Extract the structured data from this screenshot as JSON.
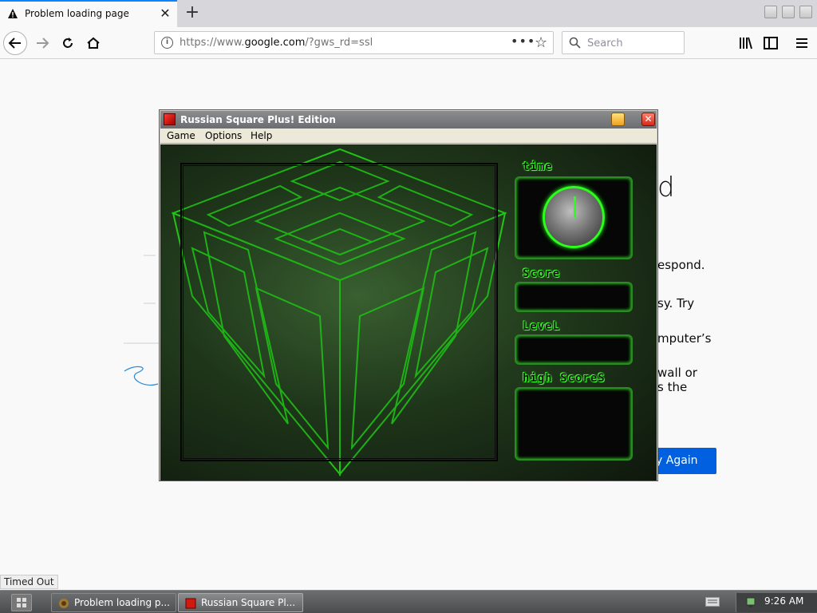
{
  "browser": {
    "tab_title": "Problem loading page",
    "url_prefix": "https://www.",
    "url_host": "google.com",
    "url_suffix": "/?gws_rd=ssl",
    "search_placeholder": "Search",
    "status_tip": "Timed Out"
  },
  "error_page": {
    "title_fragment": "d",
    "line1": "espond.",
    "line2": "sy. Try",
    "line3": "mputer’s",
    "line4": "wall or",
    "line5": "s the",
    "button": "y Again"
  },
  "game_window": {
    "title": "Russian Square Plus! Edition",
    "menu": [
      "Game",
      "Options",
      "Help"
    ],
    "panels": {
      "time_label": "time",
      "score_label": "Score",
      "level_label": "LeveL",
      "high_scores_label": "high ScoreS"
    },
    "accent_color": "#3aff2a"
  },
  "taskbar": {
    "tasks": [
      "Problem loading p...",
      "Russian Square Pl..."
    ],
    "time": "9:26 AM"
  }
}
